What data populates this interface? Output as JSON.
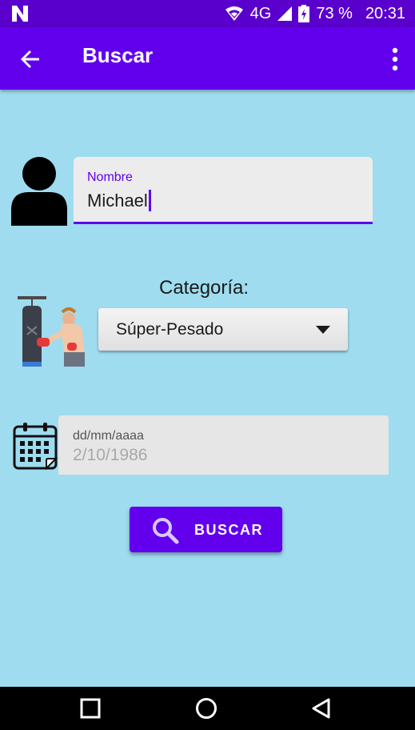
{
  "status_bar": {
    "network": "4G",
    "battery": "73 %",
    "time": "20:31"
  },
  "app_bar": {
    "title": "Buscar",
    "icons": [
      "arrow-back-icon",
      "more-vert-icon"
    ]
  },
  "form": {
    "name": {
      "label": "Nombre",
      "value": "Michael"
    },
    "category": {
      "label": "Categoría:",
      "selected": "Súper-Pesado"
    },
    "date": {
      "hint": "dd/mm/aaaa",
      "placeholder": "2/10/1986"
    },
    "search_button": {
      "label": "BUSCAR",
      "icon": "search-icon"
    }
  },
  "colors": {
    "primary": "#6200ee",
    "status_bar": "#5a00cc",
    "background": "#9fdcef",
    "field_background": "#ececec"
  },
  "nav_bar": {
    "icons": [
      "recents-square-icon",
      "home-circle-icon",
      "back-triangle-icon"
    ]
  }
}
